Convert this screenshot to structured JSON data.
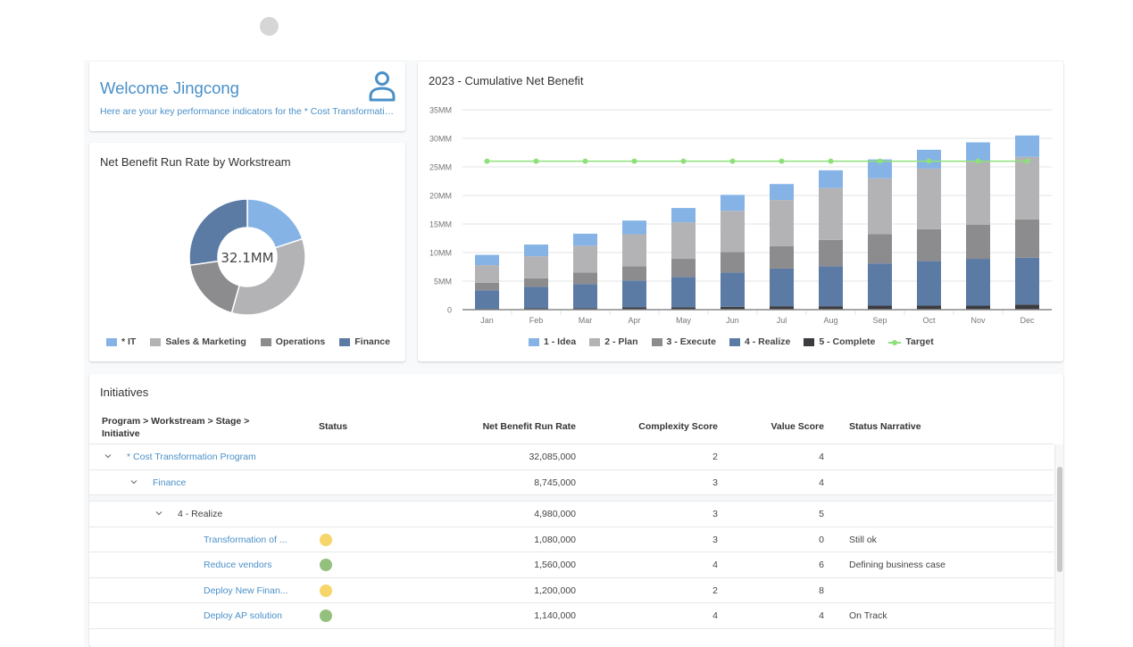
{
  "welcome": {
    "title": "Welcome Jingcong",
    "subtitle": "Here are your key performance indicators for the * Cost Transformation Program",
    "icon": "user-icon"
  },
  "colors": {
    "accent": "#4a90c8",
    "idea": "#86b3e6",
    "plan": "#b3b3b5",
    "execute": "#8c8c8e",
    "realize": "#5c7ba4",
    "complete": "#3c3c40",
    "target": "#8ee07a",
    "status_yellow": "#f6d56a",
    "status_green": "#93c07c"
  },
  "donut": {
    "title": "Net Benefit Run Rate by Workstream",
    "center_label": "32.1MM",
    "legend": [
      {
        "label": "* IT",
        "color": "#86b3e6"
      },
      {
        "label": "Sales & Marketing",
        "color": "#b3b3b5"
      },
      {
        "label": "Operations",
        "color": "#8c8c8e"
      },
      {
        "label": "Finance",
        "color": "#5c7ba4"
      }
    ]
  },
  "bar": {
    "title": "2023 - Cumulative Net Benefit",
    "legend": [
      {
        "label": "1 - Idea",
        "color": "#86b3e6"
      },
      {
        "label": "2 - Plan",
        "color": "#b3b3b5"
      },
      {
        "label": "3 - Execute",
        "color": "#8c8c8e"
      },
      {
        "label": "4 - Realize",
        "color": "#5c7ba4"
      },
      {
        "label": "5 - Complete",
        "color": "#3c3c40"
      },
      {
        "label": "Target",
        "color": "#8ee07a"
      }
    ]
  },
  "chart_data": [
    {
      "type": "pie",
      "title": "Net Benefit Run Rate by Workstream",
      "center_label": "32.1MM",
      "units": "MM",
      "categories": [
        "* IT",
        "Sales & Marketing",
        "Operations",
        "Finance"
      ],
      "values": [
        6.4,
        11.04,
        5.9,
        8.745
      ],
      "legend_position": "bottom"
    },
    {
      "type": "bar",
      "stacked": true,
      "title": "2023 - Cumulative Net Benefit",
      "units": "MM",
      "categories": [
        "Jan",
        "Feb",
        "Mar",
        "Apr",
        "May",
        "Jun",
        "Jul",
        "Aug",
        "Sep",
        "Oct",
        "Nov",
        "Dec"
      ],
      "series": [
        {
          "name": "5 - Complete",
          "values": [
            0.15,
            0.25,
            0.25,
            0.4,
            0.4,
            0.5,
            0.6,
            0.6,
            0.7,
            0.7,
            0.7,
            0.9
          ]
        },
        {
          "name": "4 - Realize",
          "values": [
            3.25,
            3.75,
            4.25,
            4.7,
            5.35,
            6.0,
            6.6,
            7.0,
            7.4,
            7.8,
            8.2,
            8.2
          ]
        },
        {
          "name": "3 - Execute",
          "values": [
            1.3,
            1.5,
            2.0,
            2.5,
            3.15,
            3.6,
            3.9,
            4.6,
            5.1,
            5.6,
            6.0,
            6.7
          ]
        },
        {
          "name": "2 - Plan",
          "values": [
            3.1,
            3.85,
            4.7,
            5.6,
            6.4,
            7.2,
            8.1,
            9.1,
            9.8,
            10.6,
            11.0,
            10.95
          ]
        },
        {
          "name": "1 - Idea",
          "values": [
            1.8,
            2.05,
            2.1,
            2.4,
            2.5,
            2.8,
            2.8,
            3.1,
            3.3,
            3.3,
            3.4,
            3.75
          ]
        }
      ],
      "line_series": [
        {
          "name": "Target",
          "values": [
            26,
            26,
            26,
            26,
            26,
            26,
            26,
            26,
            26,
            26,
            26,
            26
          ]
        }
      ],
      "yticks": [
        "0",
        "5MM",
        "10MM",
        "15MM",
        "20MM",
        "25MM",
        "30MM",
        "35MM"
      ],
      "ylim": [
        0,
        35
      ],
      "xlabel": "",
      "ylabel": "",
      "grid": true,
      "legend_position": "bottom"
    }
  ],
  "initiatives": {
    "title": "Initiatives",
    "columns": {
      "name": "Program > Workstream > Stage > Initiative",
      "status": "Status",
      "nbrr": "Net Benefit Run Rate",
      "complexity": "Complexity Score",
      "value": "Value Score",
      "narrative": "Status Narrative"
    },
    "rows": [
      {
        "level": 0,
        "expandable": true,
        "link": true,
        "name": "* Cost Transformation Program",
        "status": "",
        "nbrr": "32,085,000",
        "complexity": "2",
        "value": "4",
        "narrative": ""
      },
      {
        "level": 1,
        "expandable": true,
        "link": true,
        "name": "Finance",
        "status": "",
        "nbrr": "8,745,000",
        "complexity": "3",
        "value": "4",
        "narrative": ""
      },
      {
        "level": 2,
        "expandable": true,
        "link": false,
        "name": "4 - Realize",
        "status": "",
        "nbrr": "4,980,000",
        "complexity": "3",
        "value": "5",
        "narrative": ""
      },
      {
        "level": 3,
        "expandable": false,
        "link": true,
        "name": "Transformation of ...",
        "status": "yellow",
        "nbrr": "1,080,000",
        "complexity": "3",
        "value": "0",
        "narrative": "Still ok"
      },
      {
        "level": 3,
        "expandable": false,
        "link": true,
        "name": "Reduce vendors",
        "status": "green",
        "nbrr": "1,560,000",
        "complexity": "4",
        "value": "6",
        "narrative": "Defining business case"
      },
      {
        "level": 3,
        "expandable": false,
        "link": true,
        "name": "Deploy New Finan...",
        "status": "yellow",
        "nbrr": "1,200,000",
        "complexity": "2",
        "value": "8",
        "narrative": ""
      },
      {
        "level": 3,
        "expandable": false,
        "link": true,
        "name": "Deploy AP solution",
        "status": "green",
        "nbrr": "1,140,000",
        "complexity": "4",
        "value": "4",
        "narrative": "On Track"
      }
    ]
  }
}
